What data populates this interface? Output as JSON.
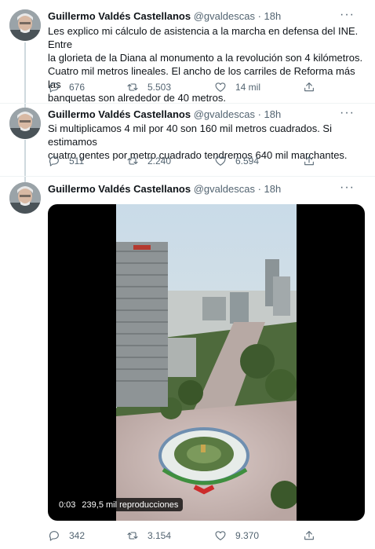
{
  "tweets": [
    {
      "author_name": "Guillermo Valdés Castellanos",
      "handle": "@gvaldescas",
      "separator": "·",
      "time": "18h",
      "text_lines": [
        "Les explico mi cálculo de asistencia a la marcha en defensa del INE. Entre",
        "la glorieta de la Diana al monumento a la revolución son 4 kilómetros.",
        "Cuatro mil metros lineales.  El ancho de los carriles de Reforma más las",
        "banquetas son alrededor de 40 metros."
      ],
      "replies": "676",
      "retweets": "5.503",
      "likes": "14 mil"
    },
    {
      "author_name": "Guillermo Valdés Castellanos",
      "handle": "@gvaldescas",
      "separator": "·",
      "time": "18h",
      "text_lines": [
        "Si multiplicamos 4 mil por 40 son 160 mil metros cuadrados. Si estimamos",
        "cuatro gentes por metro cuadrado tendremos 640 mil marchantes."
      ],
      "replies": "511",
      "retweets": "2.240",
      "likes": "6.594"
    },
    {
      "author_name": "Guillermo Valdés Castellanos",
      "handle": "@gvaldescas",
      "separator": "·",
      "time": "18h",
      "video_time": "0:03",
      "video_views": "239,5 mil reproducciones",
      "replies": "342",
      "retweets": "3.154",
      "likes": "9.370"
    }
  ],
  "icons": {
    "more": "more-icon",
    "reply": "reply-icon",
    "retweet": "retweet-icon",
    "like": "heart-icon",
    "share": "share-icon"
  },
  "colors": {
    "text": "#0f1419",
    "secondary": "#536471",
    "thread_line": "#cfd9de",
    "divider": "#eff3f4"
  }
}
